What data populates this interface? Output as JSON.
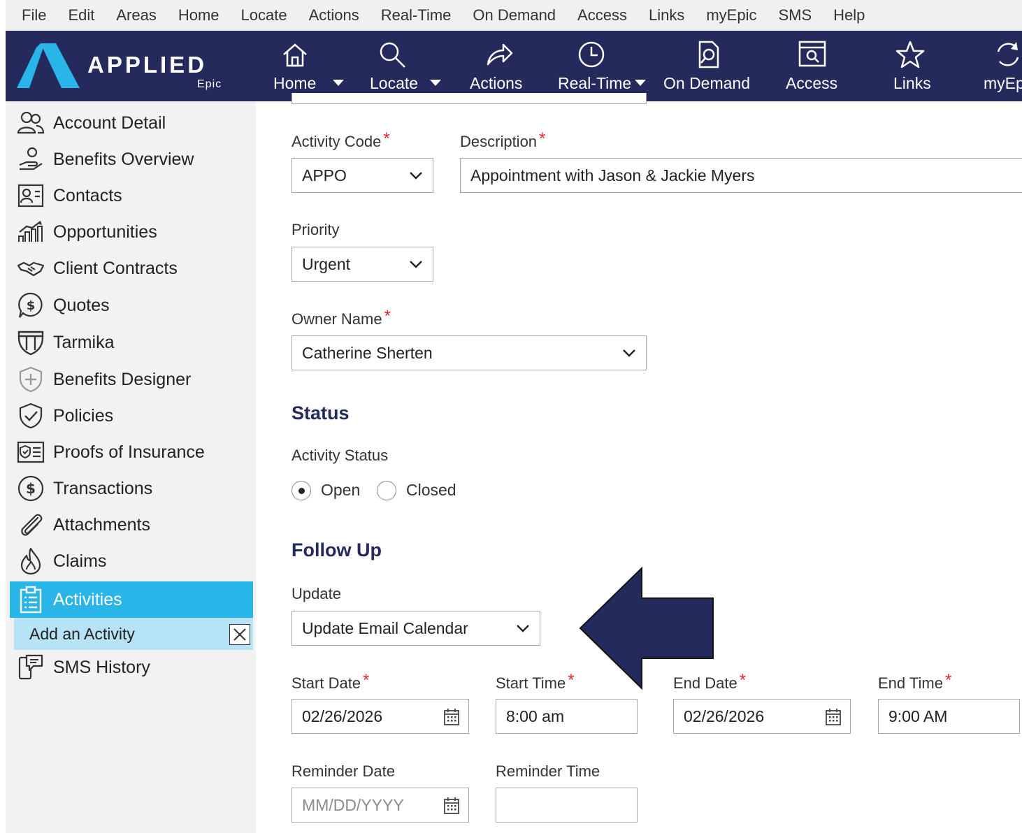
{
  "menu": [
    "File",
    "Edit",
    "Areas",
    "Home",
    "Locate",
    "Actions",
    "Real-Time",
    "On Demand",
    "Access",
    "Links",
    "myEpic",
    "SMS",
    "Help"
  ],
  "brand": {
    "name": "APPLIED",
    "sub": "Epic"
  },
  "toolbar": {
    "home": "Home",
    "locate": "Locate",
    "actions": "Actions",
    "realtime": "Real-Time",
    "ondemand": "On Demand",
    "access": "Access",
    "links": "Links",
    "myepic": "myEp"
  },
  "sidebar": {
    "items": [
      {
        "label": "Account Detail",
        "icon": "users-icon"
      },
      {
        "label": "Benefits Overview",
        "icon": "benefits-hand-icon"
      },
      {
        "label": "Contacts",
        "icon": "contact-card-icon"
      },
      {
        "label": "Opportunities",
        "icon": "growth-chart-icon"
      },
      {
        "label": "Client Contracts",
        "icon": "handshake-icon"
      },
      {
        "label": "Quotes",
        "icon": "dollar-bubble-icon"
      },
      {
        "label": "Tarmika",
        "icon": "tarmika-icon"
      },
      {
        "label": "Benefits Designer",
        "icon": "shield-plus-icon"
      },
      {
        "label": "Policies",
        "icon": "shield-check-icon"
      },
      {
        "label": "Proofs of Insurance",
        "icon": "certificate-icon"
      },
      {
        "label": "Transactions",
        "icon": "dollar-circle-icon"
      },
      {
        "label": "Attachments",
        "icon": "paperclip-icon"
      },
      {
        "label": "Claims",
        "icon": "flame-icon"
      },
      {
        "label": "Activities",
        "icon": "clipboard-list-icon"
      }
    ],
    "sub_item": "Add an Activity",
    "sms_history": "SMS History"
  },
  "form": {
    "activity_code_label": "Activity Code",
    "activity_code_value": "APPO",
    "description_label": "Description",
    "description_value": "Appointment with Jason & Jackie Myers",
    "priority_label": "Priority",
    "priority_value": "Urgent",
    "owner_label": "Owner Name",
    "owner_value": "Catherine Sherten",
    "status_heading": "Status",
    "activity_status_label": "Activity Status",
    "status_open": "Open",
    "status_closed": "Closed",
    "followup_heading": "Follow Up",
    "update_label": "Update",
    "update_value": "Update Email Calendar",
    "start_date_label": "Start Date",
    "start_date_value": "02/26/2026",
    "start_time_label": "Start Time",
    "start_time_value": "8:00 am",
    "end_date_label": "End Date",
    "end_date_value": "02/26/2026",
    "end_time_label": "End Time",
    "end_time_value": "9:00 AM",
    "reminder_date_label": "Reminder Date",
    "reminder_date_placeholder": "MM/DD/YYYY",
    "reminder_time_label": "Reminder Time",
    "required_mark": "*"
  },
  "colors": {
    "navy": "#242a5c",
    "active": "#29b5e8",
    "sub_active": "#b6e4f6",
    "required": "#e0282e",
    "arrow": "#242a5c"
  }
}
